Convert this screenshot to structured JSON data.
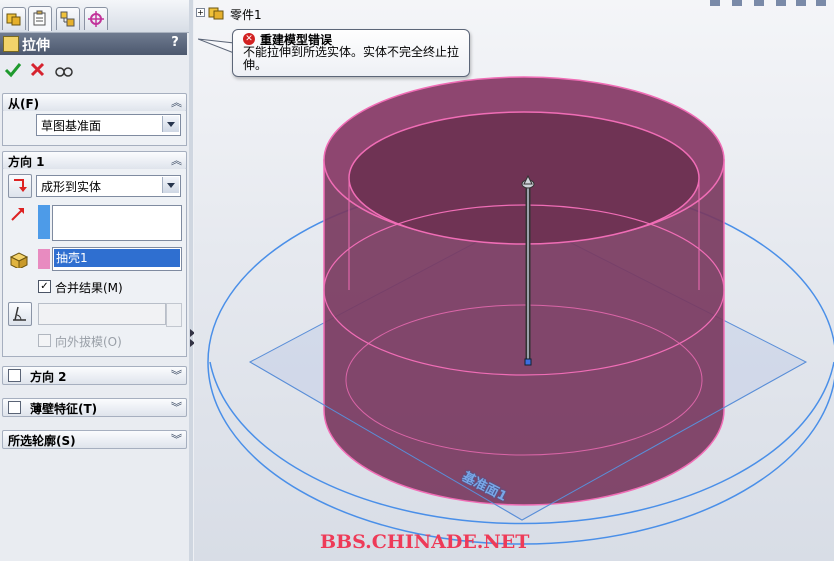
{
  "colors": {
    "accent": "#2f6fd0",
    "error": "#d22222",
    "body_fill": "#7a3a5f",
    "body_edge": "#f06db6",
    "sketch_blue": "#4a8fe8",
    "merged_bar": "#e88bc0",
    "direction_bar": "#4d9be8",
    "watermark": "#ee3b58"
  },
  "panel": {
    "tabs": [
      "feature-manager-tab",
      "property-manager-tab",
      "configuration-manager-tab",
      "dimxpert-tab"
    ],
    "title": "拉伸",
    "help": "?",
    "actions": [
      "ok-icon",
      "cancel-icon",
      "preview-icon"
    ],
    "from": {
      "label": "从(F)",
      "value": "草图基准面"
    },
    "direction1": {
      "label": "方向 1",
      "end_condition": "成形到实体",
      "body_selection": "抽壳1",
      "merge_label": "合并结果(M)",
      "merge_checked": "✓",
      "draft_outward_label": "向外拔模(O)"
    },
    "direction2": {
      "label": "方向 2"
    },
    "thin_feature": {
      "label": "薄壁特征(T)"
    },
    "selected_contours": {
      "label": "所选轮廓(S)"
    }
  },
  "viewport": {
    "tree_root": "零件1",
    "expand_symbol": "+",
    "top_icons": [
      "rotate-icon",
      "zoom-icon",
      "section-icon",
      "view-icon",
      "display-icon",
      "appearance-icon"
    ],
    "tooltip": {
      "title": "重建模型错误",
      "message": "不能拉伸到所选实体。实体不完全终止拉伸。",
      "icon": "✕"
    },
    "plane_label": "基准面1",
    "watermark": "BBS.CHINADE.NET"
  }
}
